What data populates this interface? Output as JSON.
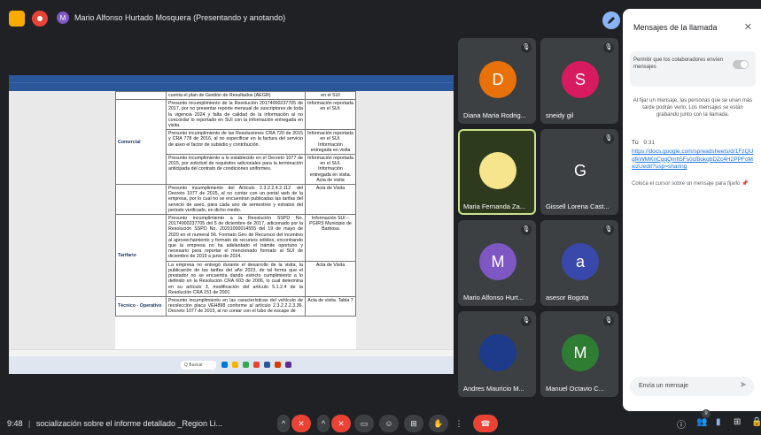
{
  "top_bar": {
    "presenter_initial": "M",
    "presenter_text": "Mario Alfonso Hurtado Mosquera (Presentando y anotando)"
  },
  "shared_document": {
    "rows": [
      {
        "category": "",
        "description": "cuenta el plan de Gestión de Resultados (AEGR)",
        "evidence": "en el SUI"
      },
      {
        "category": "Comercial",
        "description": "Presunto incumplimiento de la Resolución 20174000237705 de 2017, por no presentar reporte mensual de suscriptores de toda la vigencia 2024 y falta de calidad de la información al no concordar lo reportado en SUI con la información entregada en visita.",
        "evidence": "Información reportada en el SUI."
      },
      {
        "category": "",
        "description": "Presunto incumplimiento de las Resoluciones CRA 720 de 2015 y CRA 778 de 2016, al no especificar en la factura del servicio de aseo el factor de subsidio y contribución.",
        "evidence": "Información reportada en el SUI. Información entregada en visita"
      },
      {
        "category": "",
        "description": "Presunto incumplimiento a lo establecido en el Decreto 1077 de 2015, por solicitud de requisitos adicionales para la terminación anticipada del contrato de condiciones uniformes.",
        "evidence": "Información reportada en el SUI. Información entregada en visita. Acta de visita"
      },
      {
        "category": "",
        "description": "Presunto incumplimiento del Artículo 2.3.2.2.4.2.112. del Decreto 1077 de 2015, al no contar con un portal web de la empresa, por lo cual no se encuentran publicadas las tarifas del servicio de aseo, para cada uno de semestres y estratos del periodo verificado, en dicho medio.",
        "evidence": "Acta de Visita"
      },
      {
        "category": "Tarifario",
        "description": "Presunto incumplimiento a la Resolución SSPD No. 20174000237705 del 5 de diciembre de 2017, adicionado por la Resolución SSPD No. 20201000014555 del 19 de mayo de 2020 en el numeral 56. Formato Giro de Recursos del incentivo al aprovechamiento y formato de recursos sólidos, encontrando que la empresa no ha adelantado el trámite oportuno y necesario para reportar el mencionado formato al SUI de diciembre de 2019 a junio de 2024.",
        "evidence": "Información SUI – PGIRS Municipio de Barbosa"
      },
      {
        "category": "",
        "description": "La empresa no entregó durante el desarrollo de la visita, la publicación de las tarifas del año 2023, de tal forma que el prestador no se encuentra dando estricto cumplimiento a lo definido en la Resolución CRA 603 de 2006, lo cual determina en su artículo 3, modificación del artículo 5.1.2.4 de la Resolución CRA 151 de 2001",
        "evidence": "Acta de Visita"
      },
      {
        "category": "Técnico - Operativo",
        "description": "Presunto incumplimiento en las características del vehículo de recolección placa VEH898 conforme al artículo 2.3.2.2.2.3.36. Decreto 1077 de 2015, al no contar con el tubo de escape de",
        "evidence": "Acta de visita. Tabla 7"
      }
    ],
    "taskbar_search": "Q Buscar"
  },
  "participants": [
    {
      "name": "Diana Maria Rodrig...",
      "initial": "D",
      "color": "#e8710a",
      "muted": true
    },
    {
      "name": "sneidy gil",
      "initial": "S",
      "color": "#d81b60",
      "muted": true
    },
    {
      "name": "Maria Fernanda Za...",
      "initial": "",
      "color": "#f6e58d",
      "muted": false,
      "speaking": true
    },
    {
      "name": "Gissell Lorena Cast...",
      "initial": "G",
      "color": "#3c4043",
      "muted": true
    },
    {
      "name": "Mario Alfonso Hurt...",
      "initial": "M",
      "color": "#7e57c2",
      "muted": true
    },
    {
      "name": "asesor Bogota",
      "initial": "a",
      "color": "#3949ab",
      "muted": true
    },
    {
      "name": "Andres Mauricio M...",
      "initial": "",
      "color": "#1e3a8a",
      "muted": true
    },
    {
      "name": "Manuel Octavio C...",
      "initial": "M",
      "color": "#2e7d32",
      "muted": true
    }
  ],
  "chat": {
    "title": "Mensajes de la llamada",
    "permission_text": "Permitir que los colaboradores envíen mensajes",
    "pin_note": "Al fijar un mensaje, las personas que se unan más tarde podrán verlo. Los mensajes se están grabando junto con la llamada.",
    "message_author": "Tú",
    "message_time": "9:31",
    "message_link": "https://docs.google.com/spreadsheets/d/1FzQUgfkWMKnCgqQmh5Fs0cf8okqbDZc4H2PPFoMwzUedit?usp=sharing",
    "pin_hint": "Coloca el cursor sobre un mensaje para fijarlo",
    "input_placeholder": "Envía un mensaje"
  },
  "bottom_bar": {
    "time": "9:48",
    "meeting_title": "socialización sobre el informe detallado _Region Li...",
    "participant_count": "9"
  }
}
